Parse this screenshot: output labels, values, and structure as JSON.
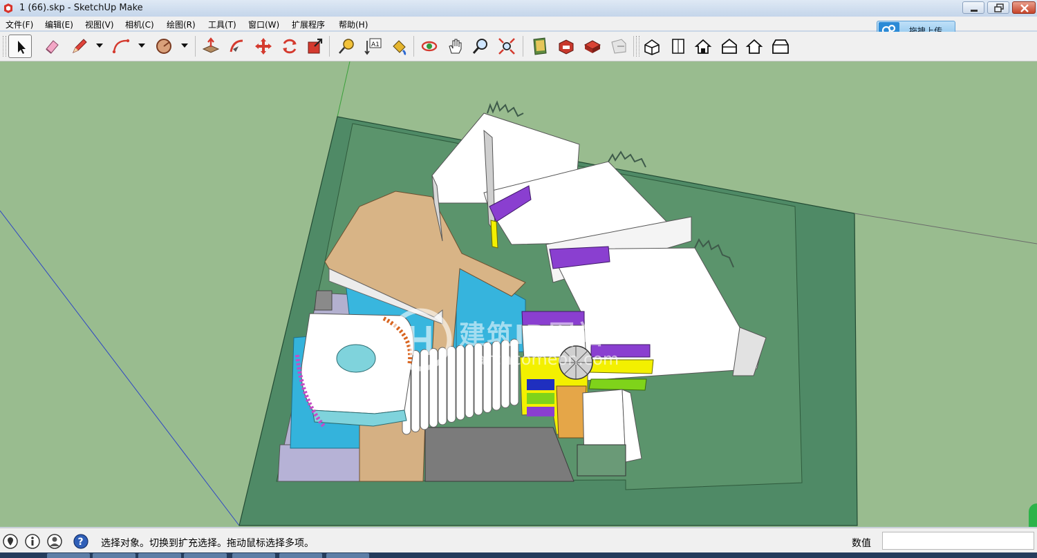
{
  "window": {
    "title": "1 (66).skp - SketchUp Make",
    "app_icon": "sketchup-icon",
    "controls": [
      "minimize-icon",
      "maximize-icon",
      "close-icon"
    ]
  },
  "menu": {
    "items": [
      {
        "label": "文件(F)"
      },
      {
        "label": "编辑(E)"
      },
      {
        "label": "视图(V)"
      },
      {
        "label": "相机(C)"
      },
      {
        "label": "绘图(R)"
      },
      {
        "label": "工具(T)"
      },
      {
        "label": "窗口(W)"
      },
      {
        "label": "扩展程序"
      },
      {
        "label": "帮助(H)"
      }
    ]
  },
  "upload": {
    "label": "拖拽上传",
    "icon": "cloud-upload-icon"
  },
  "toolbar": {
    "tools": [
      "select-icon",
      "eraser-icon",
      "pencil-icon",
      "arc-icon",
      "polygon-icon",
      "push-pull-icon",
      "follow-me-icon",
      "move-icon",
      "rotate-icon",
      "scale-icon",
      "tape-measure-icon",
      "text-icon",
      "paint-bucket-icon",
      "orbit-icon",
      "pan-icon",
      "zoom-icon",
      "zoom-extents-icon",
      "warehouse-icon",
      "share-model-icon",
      "components-icon",
      "extension-icon",
      "iso-view-icon",
      "top-view-icon",
      "front-view-icon",
      "right-view-icon",
      "back-view-icon",
      "left-view-icon"
    ],
    "text_tool_label": "A1"
  },
  "watermark": {
    "brand": "建筑ID图站",
    "url": "archcomeon.com"
  },
  "status": {
    "message": "选择对象。切换到扩充选择。拖动鼠标选择多项。",
    "measurements_label": "数值",
    "measurements_value": "",
    "icons": [
      "geo-location-icon",
      "credits-icon",
      "user-icon",
      "help-icon"
    ]
  },
  "colors": {
    "sky": "#99bc8f",
    "ground": "#4f8a66",
    "water": "#34b3dc",
    "wood": "#d8b486",
    "purple": "#8a3fd0",
    "yellow": "#f3f000",
    "lime": "#7fd31a"
  }
}
